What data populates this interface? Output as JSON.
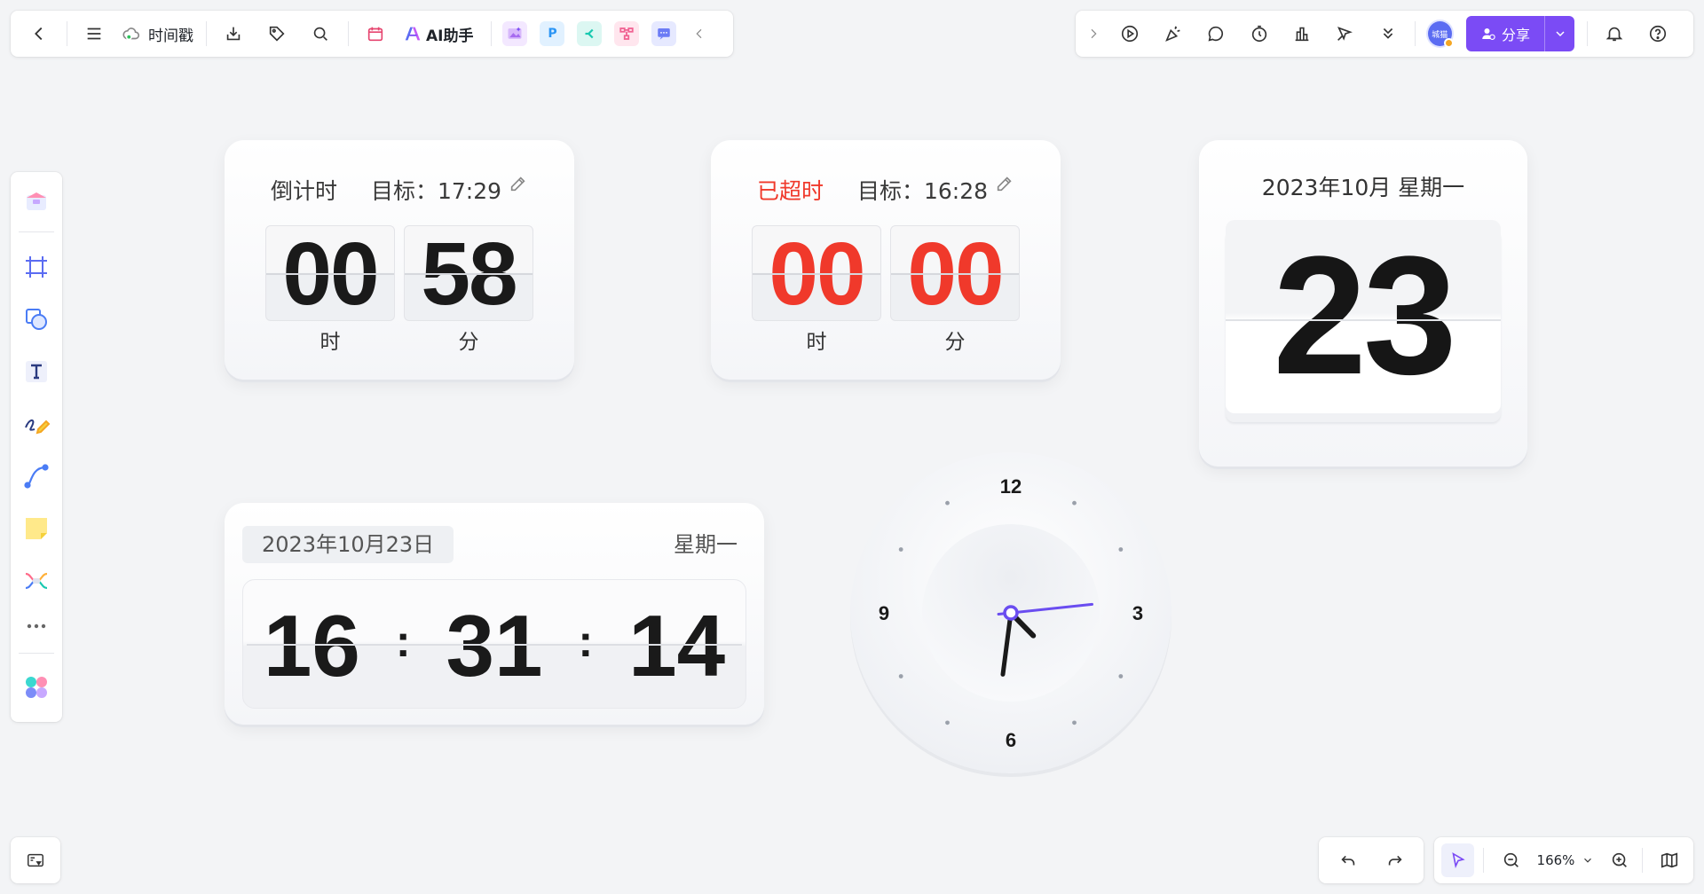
{
  "toolbar": {
    "doc_title": "时间戳",
    "ai_label": "AI助手",
    "app_icons": [
      {
        "name": "image-ai-icon",
        "glyph": "",
        "color": "#c28cf5"
      },
      {
        "name": "p-app-icon",
        "glyph": "P",
        "color": "#2b95f5"
      },
      {
        "name": "mindmap-icon",
        "glyph": "",
        "color": "#19c9b0"
      },
      {
        "name": "flowchart-icon",
        "glyph": "",
        "color": "#f06292"
      },
      {
        "name": "comment-app-icon",
        "glyph": "",
        "color": "#6c7cf5"
      }
    ]
  },
  "top_right": {
    "avatar_text": "城猫",
    "share_label": "分享"
  },
  "countdown": {
    "label": "倒计时",
    "target": "目标：17:29",
    "hours": "00",
    "minutes": "58",
    "hours_unit": "时",
    "minutes_unit": "分"
  },
  "overtime": {
    "label": "已超时",
    "target": "目标：16:28",
    "hours": "00",
    "minutes": "00",
    "hours_unit": "时",
    "minutes_unit": "分"
  },
  "calendar": {
    "title": "2023年10月 星期一",
    "day": "23"
  },
  "digital_clock": {
    "date": "2023年10月23日",
    "weekday": "星期一",
    "hours": "16",
    "minutes": "31",
    "seconds": "14",
    "separator": ":"
  },
  "analog_clock": {
    "numbers": [
      "12",
      "3",
      "6",
      "9"
    ],
    "time": {
      "h": 4,
      "m": 31,
      "s": 14
    }
  },
  "zoom": {
    "value": "166%"
  },
  "colors": {
    "accent": "#7b4bf5",
    "overtime_red": "#f0392b",
    "second_hand": "#6a4df0"
  }
}
